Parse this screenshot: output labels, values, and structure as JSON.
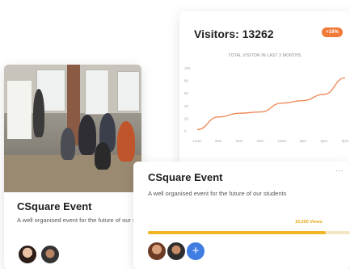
{
  "visitors_card": {
    "title": "Visitors: 13262",
    "badge": "+16%",
    "chart_subtitle": "TOTAL VISITOR IN LAST 3 MONTHS",
    "accent_color": "#f07a3a"
  },
  "chart_data": {
    "type": "line",
    "title": "",
    "xlabel": "",
    "ylabel": "",
    "y_ticks": [
      "100",
      "80",
      "60",
      "40",
      "20",
      "0"
    ],
    "ylim": [
      0,
      100
    ],
    "categories": [
      "12am",
      "3am",
      "6am",
      "9am",
      "12am",
      "3pm",
      "6pm",
      "9pm"
    ],
    "series": [
      {
        "values": [
          2,
          22,
          28,
          30,
          44,
          48,
          58,
          84
        ]
      }
    ],
    "grid": false,
    "line_color": "#f08a5a"
  },
  "event_left": {
    "title": "CSquare Event",
    "description": "A well organised event for the future of our students"
  },
  "event_right": {
    "title": "CSquare Event",
    "menu": "···",
    "description": "A well organised event for the future of our students",
    "views": "15,000 Views",
    "progress": 0.88,
    "add_label": "+"
  }
}
